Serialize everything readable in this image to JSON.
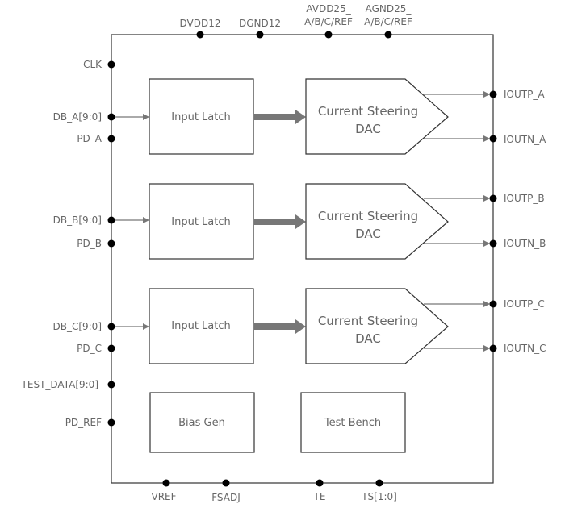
{
  "top_pins": [
    {
      "line1": "",
      "line2": "DVDD12"
    },
    {
      "line1": "",
      "line2": "DGND12"
    },
    {
      "line1": "AVDD25_",
      "line2": "A/B/C/REF"
    },
    {
      "line1": "AGND25_",
      "line2": "A/B/C/REF"
    }
  ],
  "left_pins": [
    "CLK",
    "DB_A[9:0]",
    "PD_A",
    "DB_B[9:0]",
    "PD_B",
    "DB_C[9:0]",
    "PD_C",
    "TEST_DATA[9:0]",
    "PD_REF"
  ],
  "right_pins": [
    "IOUTP_A",
    "IOUTN_A",
    "IOUTP_B",
    "IOUTN_B",
    "IOUTP_C",
    "IOUTN_C"
  ],
  "bottom_pins": [
    "VREF",
    "FSADJ",
    "TE",
    "TS[1:0]"
  ],
  "channels": [
    {
      "latch": "Input Latch",
      "dac_line1": "Current Steering",
      "dac_line2": "DAC"
    },
    {
      "latch": "Input Latch",
      "dac_line1": "Current Steering",
      "dac_line2": "DAC"
    },
    {
      "latch": "Input Latch",
      "dac_line1": "Current Steering",
      "dac_line2": "DAC"
    }
  ],
  "blocks": {
    "bias": "Bias Gen",
    "test": "Test Bench"
  },
  "colors": {
    "line": "#333333",
    "arrow": "#777777",
    "text": "#666666",
    "pin": "#000000"
  }
}
